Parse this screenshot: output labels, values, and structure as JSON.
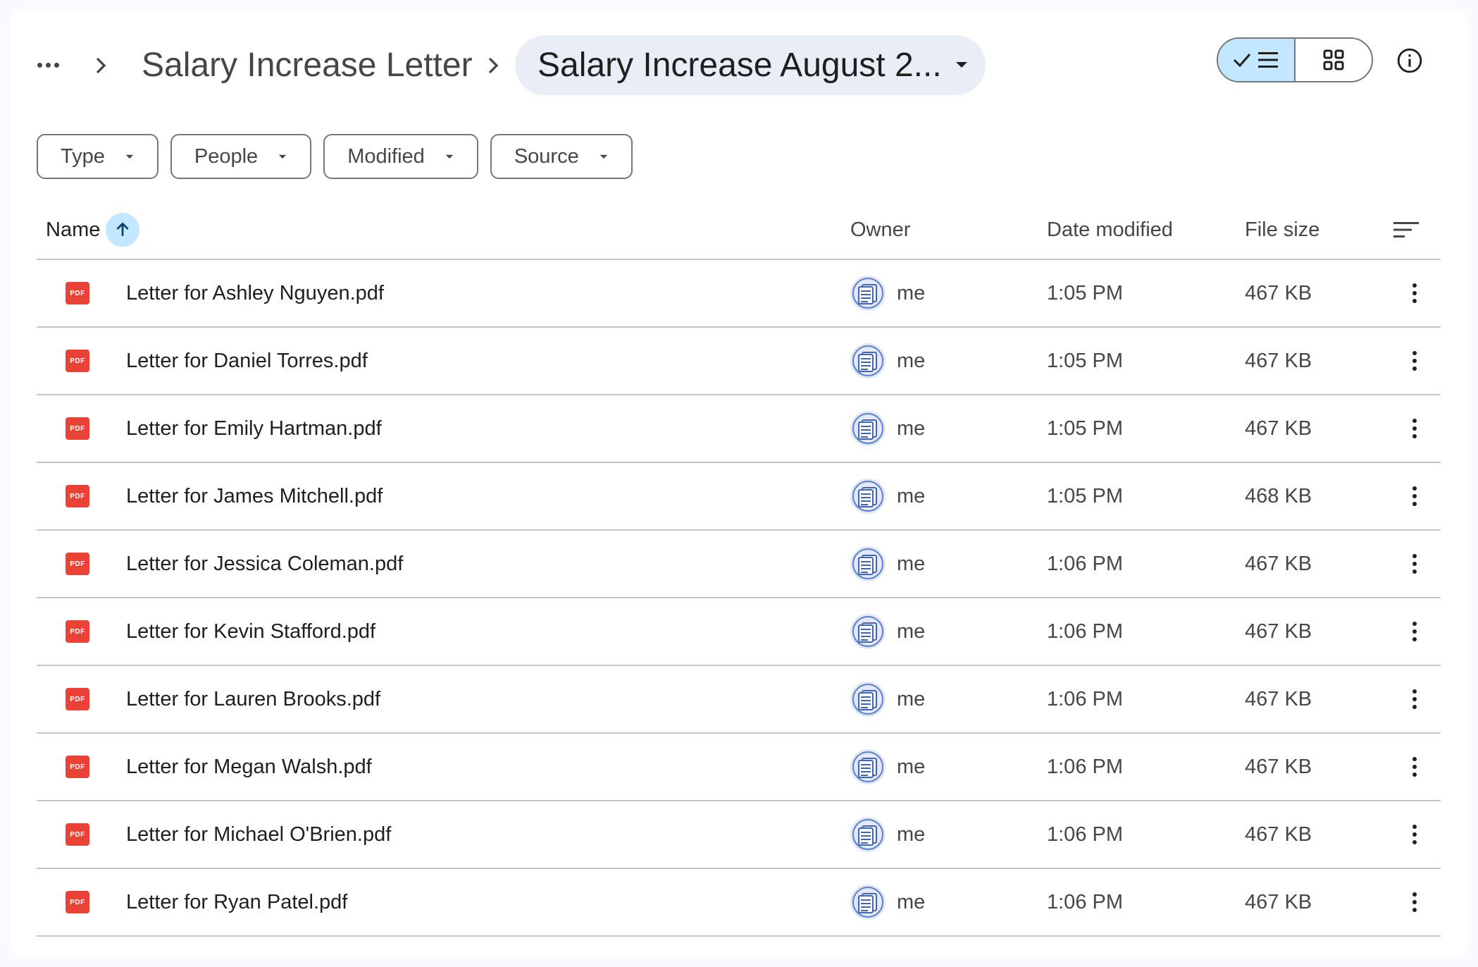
{
  "breadcrumb": {
    "parent": "Salary Increase Letter",
    "current": "Salary Increase August 2..."
  },
  "icons": {
    "more": "more-horiz-icon",
    "separator": "chevron-right-icon",
    "dropdown": "arrow-drop-down-icon",
    "list_view": "list-view-icon",
    "grid_view": "grid-view-icon",
    "info": "info-icon",
    "sort_asc": "arrow-upward-icon",
    "sort_options": "sort-icon",
    "file": "pdf-icon",
    "owner": "owner-avatar-icon",
    "row_menu": "more-vert-icon"
  },
  "colors": {
    "accent_bg": "#c2e7ff",
    "pdf_red": "#ea4335",
    "breadcrumb_chip_bg": "#e9eef6"
  },
  "filters": [
    {
      "label": "Type"
    },
    {
      "label": "People"
    },
    {
      "label": "Modified"
    },
    {
      "label": "Source"
    }
  ],
  "table": {
    "columns": {
      "name": "Name",
      "owner": "Owner",
      "date": "Date modified",
      "size": "File size"
    },
    "pdf_badge": "PDF",
    "rows": [
      {
        "name": "Letter for Ashley Nguyen.pdf",
        "owner": "me",
        "date": "1:05 PM",
        "size": "467 KB"
      },
      {
        "name": "Letter for Daniel Torres.pdf",
        "owner": "me",
        "date": "1:05 PM",
        "size": "467 KB"
      },
      {
        "name": "Letter for Emily Hartman.pdf",
        "owner": "me",
        "date": "1:05 PM",
        "size": "467 KB"
      },
      {
        "name": "Letter for James Mitchell.pdf",
        "owner": "me",
        "date": "1:05 PM",
        "size": "468 KB"
      },
      {
        "name": "Letter for Jessica Coleman.pdf",
        "owner": "me",
        "date": "1:06 PM",
        "size": "467 KB"
      },
      {
        "name": "Letter for Kevin Stafford.pdf",
        "owner": "me",
        "date": "1:06 PM",
        "size": "467 KB"
      },
      {
        "name": "Letter for Lauren Brooks.pdf",
        "owner": "me",
        "date": "1:06 PM",
        "size": "467 KB"
      },
      {
        "name": "Letter for Megan Walsh.pdf",
        "owner": "me",
        "date": "1:06 PM",
        "size": "467 KB"
      },
      {
        "name": "Letter for Michael O'Brien.pdf",
        "owner": "me",
        "date": "1:06 PM",
        "size": "467 KB"
      },
      {
        "name": "Letter for Ryan Patel.pdf",
        "owner": "me",
        "date": "1:06 PM",
        "size": "467 KB"
      }
    ]
  }
}
